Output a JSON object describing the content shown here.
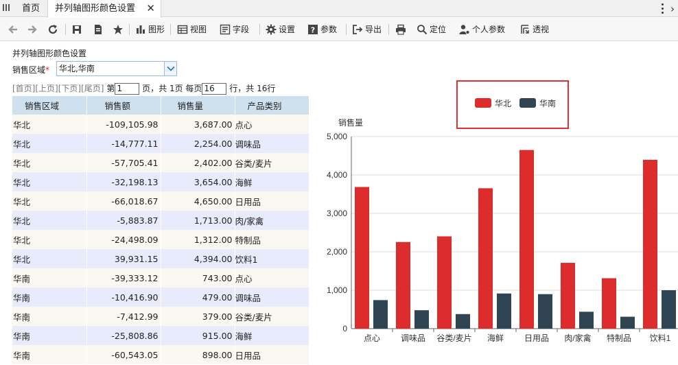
{
  "tabs": {
    "home_label": "首页",
    "active_label": "并列轴图形颜色设置",
    "close_glyph": "✕",
    "next_glyph": "›"
  },
  "toolbar": {
    "graph_label": "图形",
    "view_label": "视图",
    "field_label": "字段",
    "settings_label": "设置",
    "params_label": "参数",
    "export_label": "导出",
    "locate_label": "定位",
    "personal_params_label": "个人参数",
    "pivot_label": "透视"
  },
  "report": {
    "title": "并列轴图形颜色设置",
    "param_label": "销售区域",
    "param_required_mark": "*",
    "param_value": "华北,华南"
  },
  "paging": {
    "first": "[首页]",
    "prev": "[上页]",
    "next": "[下页]",
    "last": "[尾页]",
    "page_prefix": "第",
    "page_value": "1",
    "page_suffix": "页，共 1页 每页",
    "page_size": "16",
    "rows_suffix": "行，共 16行"
  },
  "table": {
    "headers": [
      "销售区域",
      "销售额",
      "销售量",
      "产品类别"
    ],
    "rows": [
      [
        "华北",
        "-109,105.98",
        "3,687.00",
        "点心"
      ],
      [
        "华北",
        "-14,777.11",
        "2,254.00",
        "调味品"
      ],
      [
        "华北",
        "-57,705.41",
        "2,402.00",
        "谷类/麦片"
      ],
      [
        "华北",
        "-32,198.13",
        "3,654.00",
        "海鲜"
      ],
      [
        "华北",
        "-66,018.67",
        "4,650.00",
        "日用品"
      ],
      [
        "华北",
        "-5,883.87",
        "1,713.00",
        "肉/家禽"
      ],
      [
        "华北",
        "-24,498.09",
        "1,312.00",
        "特制品"
      ],
      [
        "华北",
        "39,931.15",
        "4,394.00",
        "饮料1"
      ],
      [
        "华南",
        "-39,333.12",
        "743.00",
        "点心"
      ],
      [
        "华南",
        "-10,416.90",
        "479.00",
        "调味品"
      ],
      [
        "华南",
        "-7,412.99",
        "379.00",
        "谷类/麦片"
      ],
      [
        "华南",
        "-25,808.86",
        "915.00",
        "海鲜"
      ],
      [
        "华南",
        "-60,543.05",
        "898.00",
        "日用品"
      ]
    ]
  },
  "chart_data": {
    "type": "bar",
    "ylabel": "销售量",
    "categories": [
      "点心",
      "调味品",
      "谷类/麦片",
      "海鲜",
      "日用品",
      "肉/家禽",
      "特制品",
      "饮料1"
    ],
    "series": [
      {
        "name": "华北",
        "color": "#dd2c2c",
        "values": [
          3687,
          2254,
          2402,
          3654,
          4650,
          1713,
          1312,
          4394
        ]
      },
      {
        "name": "华南",
        "color": "#2f4554",
        "values": [
          743,
          479,
          379,
          915,
          898,
          440,
          310,
          1000
        ]
      }
    ],
    "ylim": [
      0,
      5000
    ],
    "yticks": [
      "0",
      "1,000",
      "2,000",
      "3,000",
      "4,000",
      "5,000"
    ],
    "grid": true,
    "legend_position": "top-right",
    "legend_highlight_color": "#e23030"
  }
}
